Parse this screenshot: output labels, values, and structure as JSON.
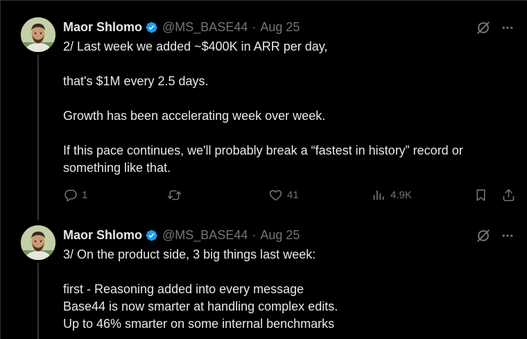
{
  "tweets": [
    {
      "author": {
        "name": "Maor Shlomo",
        "handle": "@MS_BASE44",
        "verified": true
      },
      "separator": "·",
      "date": "Aug 25",
      "paragraphs": [
        "2/ Last week we added ~$400K in ARR per day,",
        "that's $1M every 2.5 days.",
        "Growth has been accelerating week over week.",
        "If this pace continues, we'll probably break a “fastest in history” record or something like that."
      ],
      "actions": {
        "replies": "1",
        "retweets": "",
        "likes": "41",
        "views": "4.9K"
      }
    },
    {
      "author": {
        "name": "Maor Shlomo",
        "handle": "@MS_BASE44",
        "verified": true
      },
      "separator": "·",
      "date": "Aug 25",
      "paragraphs": [
        "3/ On the product side, 3 big things last week:",
        "first - Reasoning added into every message\nBase44 is now smarter at handling complex edits.\nUp to 46% smarter on some internal benchmarks"
      ]
    }
  ],
  "colors": {
    "background": "#000000",
    "text": "#e7e9ea",
    "muted": "#71767b",
    "verified": "#1d9bf0",
    "divider": "#2f3336"
  }
}
